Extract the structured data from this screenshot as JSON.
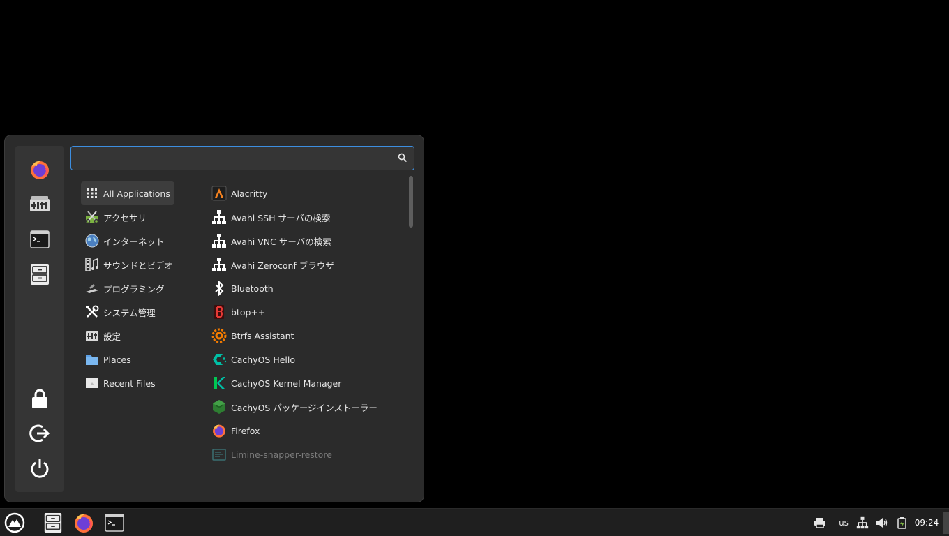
{
  "search": {
    "placeholder": ""
  },
  "favorites": [
    "firefox-icon",
    "settings-app-icon",
    "terminal-icon",
    "file-manager-icon"
  ],
  "session": [
    "lock-icon",
    "logout-icon",
    "power-icon"
  ],
  "categories": [
    {
      "label": "All Applications",
      "icon": "grid-icon"
    },
    {
      "label": "アクセサリ",
      "icon": "accessories-icon"
    },
    {
      "label": "インターネット",
      "icon": "globe-icon"
    },
    {
      "label": "サウンドとビデオ",
      "icon": "multimedia-icon"
    },
    {
      "label": "プログラミング",
      "icon": "programming-icon"
    },
    {
      "label": "システム管理",
      "icon": "tools-icon"
    },
    {
      "label": "設定",
      "icon": "settings-icon"
    },
    {
      "label": "Places",
      "icon": "folder-icon"
    },
    {
      "label": "Recent Files",
      "icon": "recent-icon"
    }
  ],
  "apps": [
    {
      "label": "Alacritty",
      "icon": "alacritty-icon"
    },
    {
      "label": "Avahi SSH サーバの検索",
      "icon": "network-icon"
    },
    {
      "label": "Avahi VNC サーバの検索",
      "icon": "network-icon"
    },
    {
      "label": "Avahi Zeroconf ブラウザ",
      "icon": "network-icon"
    },
    {
      "label": "Bluetooth",
      "icon": "bluetooth-icon"
    },
    {
      "label": "btop++",
      "icon": "btop-icon"
    },
    {
      "label": "Btrfs Assistant",
      "icon": "btrfs-icon"
    },
    {
      "label": "CachyOS Hello",
      "icon": "cachyos-hello-icon"
    },
    {
      "label": "CachyOS Kernel Manager",
      "icon": "kernel-manager-icon"
    },
    {
      "label": "CachyOS パッケージインストーラー",
      "icon": "package-installer-icon"
    },
    {
      "label": "Firefox",
      "icon": "firefox-icon"
    },
    {
      "label": "Limine-snapper-restore",
      "icon": "limine-icon"
    }
  ],
  "tray": {
    "keyboard": "us",
    "clock": "09:24"
  },
  "colors": {
    "accent": "#3d8ee0",
    "menu_bg": "#2b2b2b",
    "panel_bg": "#1f1f1f"
  }
}
